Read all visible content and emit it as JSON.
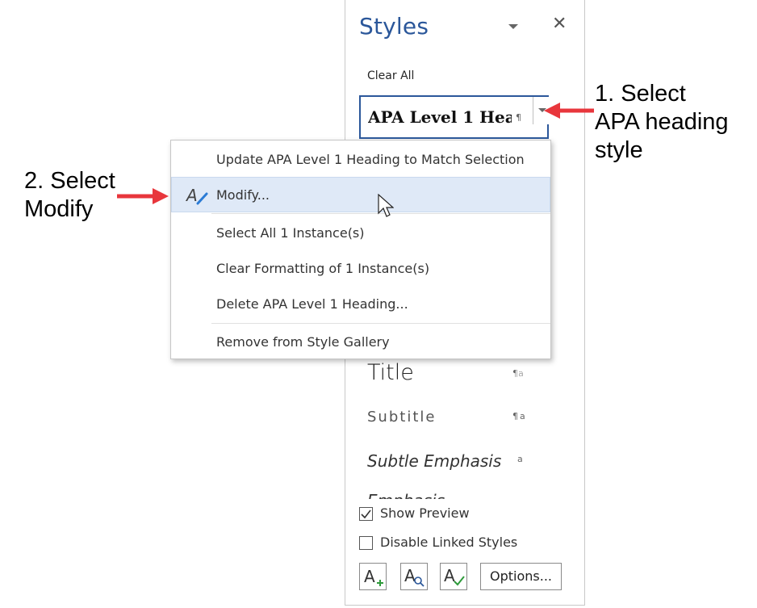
{
  "panel": {
    "title": "Styles",
    "clear_all": "Clear All",
    "selected_style": "APA Level 1 Hea",
    "selected_mark": "¶",
    "styles": [
      {
        "label": "Title",
        "mark": "¶a"
      },
      {
        "label": "Subtitle",
        "mark": "¶a"
      },
      {
        "label": "Subtle Emphasis",
        "mark": "a"
      },
      {
        "label": "Emphasis",
        "mark": ""
      }
    ],
    "show_preview": "Show Preview",
    "show_preview_checked": true,
    "disable_linked": "Disable Linked Styles",
    "disable_linked_checked": false,
    "options_button": "Options..."
  },
  "menu": {
    "items": [
      {
        "label": "Update APA Level 1 Heading to Match Selection"
      },
      {
        "label": "Modify..."
      },
      {
        "label": "Select All 1 Instance(s)"
      },
      {
        "label": "Clear Formatting of 1 Instance(s)"
      },
      {
        "label": "Delete APA Level 1 Heading..."
      },
      {
        "label": "Remove from Style Gallery"
      }
    ]
  },
  "annotations": {
    "step1_line1": "1. Select",
    "step1_line2": "APA heading",
    "step1_line3": "style",
    "step2_line1": "2. Select",
    "step2_line2": "Modify"
  },
  "colors": {
    "accent": "#2b579a",
    "arrow": "#e8363c",
    "highlight": "#dfe9f7"
  }
}
